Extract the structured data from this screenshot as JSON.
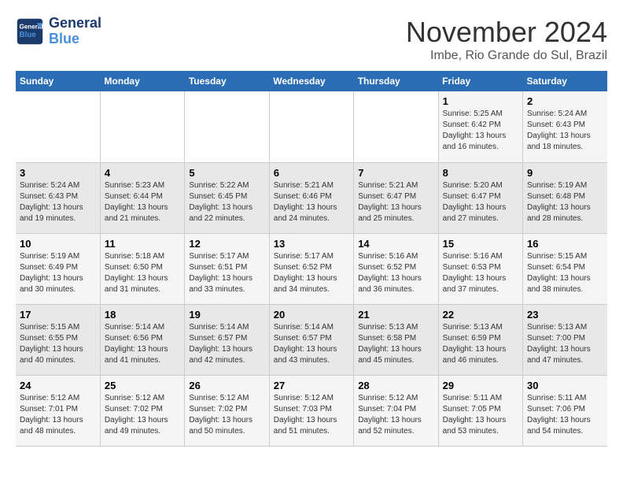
{
  "header": {
    "logo_line1": "General",
    "logo_line2": "Blue",
    "month_year": "November 2024",
    "location": "Imbe, Rio Grande do Sul, Brazil"
  },
  "weekdays": [
    "Sunday",
    "Monday",
    "Tuesday",
    "Wednesday",
    "Thursday",
    "Friday",
    "Saturday"
  ],
  "weeks": [
    [
      {
        "day": "",
        "info": ""
      },
      {
        "day": "",
        "info": ""
      },
      {
        "day": "",
        "info": ""
      },
      {
        "day": "",
        "info": ""
      },
      {
        "day": "",
        "info": ""
      },
      {
        "day": "1",
        "info": "Sunrise: 5:25 AM\nSunset: 6:42 PM\nDaylight: 13 hours and 16 minutes."
      },
      {
        "day": "2",
        "info": "Sunrise: 5:24 AM\nSunset: 6:43 PM\nDaylight: 13 hours and 18 minutes."
      }
    ],
    [
      {
        "day": "3",
        "info": "Sunrise: 5:24 AM\nSunset: 6:43 PM\nDaylight: 13 hours and 19 minutes."
      },
      {
        "day": "4",
        "info": "Sunrise: 5:23 AM\nSunset: 6:44 PM\nDaylight: 13 hours and 21 minutes."
      },
      {
        "day": "5",
        "info": "Sunrise: 5:22 AM\nSunset: 6:45 PM\nDaylight: 13 hours and 22 minutes."
      },
      {
        "day": "6",
        "info": "Sunrise: 5:21 AM\nSunset: 6:46 PM\nDaylight: 13 hours and 24 minutes."
      },
      {
        "day": "7",
        "info": "Sunrise: 5:21 AM\nSunset: 6:47 PM\nDaylight: 13 hours and 25 minutes."
      },
      {
        "day": "8",
        "info": "Sunrise: 5:20 AM\nSunset: 6:47 PM\nDaylight: 13 hours and 27 minutes."
      },
      {
        "day": "9",
        "info": "Sunrise: 5:19 AM\nSunset: 6:48 PM\nDaylight: 13 hours and 28 minutes."
      }
    ],
    [
      {
        "day": "10",
        "info": "Sunrise: 5:19 AM\nSunset: 6:49 PM\nDaylight: 13 hours and 30 minutes."
      },
      {
        "day": "11",
        "info": "Sunrise: 5:18 AM\nSunset: 6:50 PM\nDaylight: 13 hours and 31 minutes."
      },
      {
        "day": "12",
        "info": "Sunrise: 5:17 AM\nSunset: 6:51 PM\nDaylight: 13 hours and 33 minutes."
      },
      {
        "day": "13",
        "info": "Sunrise: 5:17 AM\nSunset: 6:52 PM\nDaylight: 13 hours and 34 minutes."
      },
      {
        "day": "14",
        "info": "Sunrise: 5:16 AM\nSunset: 6:52 PM\nDaylight: 13 hours and 36 minutes."
      },
      {
        "day": "15",
        "info": "Sunrise: 5:16 AM\nSunset: 6:53 PM\nDaylight: 13 hours and 37 minutes."
      },
      {
        "day": "16",
        "info": "Sunrise: 5:15 AM\nSunset: 6:54 PM\nDaylight: 13 hours and 38 minutes."
      }
    ],
    [
      {
        "day": "17",
        "info": "Sunrise: 5:15 AM\nSunset: 6:55 PM\nDaylight: 13 hours and 40 minutes."
      },
      {
        "day": "18",
        "info": "Sunrise: 5:14 AM\nSunset: 6:56 PM\nDaylight: 13 hours and 41 minutes."
      },
      {
        "day": "19",
        "info": "Sunrise: 5:14 AM\nSunset: 6:57 PM\nDaylight: 13 hours and 42 minutes."
      },
      {
        "day": "20",
        "info": "Sunrise: 5:14 AM\nSunset: 6:57 PM\nDaylight: 13 hours and 43 minutes."
      },
      {
        "day": "21",
        "info": "Sunrise: 5:13 AM\nSunset: 6:58 PM\nDaylight: 13 hours and 45 minutes."
      },
      {
        "day": "22",
        "info": "Sunrise: 5:13 AM\nSunset: 6:59 PM\nDaylight: 13 hours and 46 minutes."
      },
      {
        "day": "23",
        "info": "Sunrise: 5:13 AM\nSunset: 7:00 PM\nDaylight: 13 hours and 47 minutes."
      }
    ],
    [
      {
        "day": "24",
        "info": "Sunrise: 5:12 AM\nSunset: 7:01 PM\nDaylight: 13 hours and 48 minutes."
      },
      {
        "day": "25",
        "info": "Sunrise: 5:12 AM\nSunset: 7:02 PM\nDaylight: 13 hours and 49 minutes."
      },
      {
        "day": "26",
        "info": "Sunrise: 5:12 AM\nSunset: 7:02 PM\nDaylight: 13 hours and 50 minutes."
      },
      {
        "day": "27",
        "info": "Sunrise: 5:12 AM\nSunset: 7:03 PM\nDaylight: 13 hours and 51 minutes."
      },
      {
        "day": "28",
        "info": "Sunrise: 5:12 AM\nSunset: 7:04 PM\nDaylight: 13 hours and 52 minutes."
      },
      {
        "day": "29",
        "info": "Sunrise: 5:11 AM\nSunset: 7:05 PM\nDaylight: 13 hours and 53 minutes."
      },
      {
        "day": "30",
        "info": "Sunrise: 5:11 AM\nSunset: 7:06 PM\nDaylight: 13 hours and 54 minutes."
      }
    ]
  ]
}
